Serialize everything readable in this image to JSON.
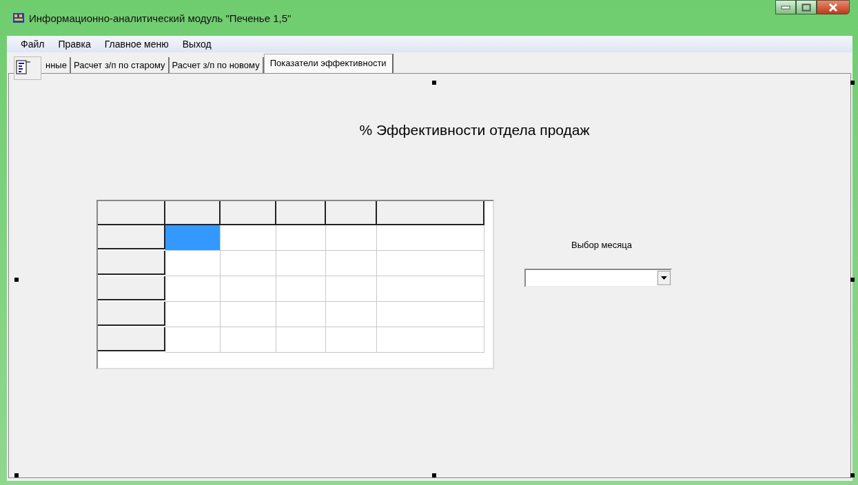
{
  "window": {
    "title": "Информационно-аналитический модуль \"Печенье 1,5\""
  },
  "menu": [
    "Файл",
    "Правка",
    "Главное меню",
    "Выход"
  ],
  "tabs": [
    {
      "label": "нные",
      "selected": false
    },
    {
      "label": "Расчет з/п по старому",
      "selected": false
    },
    {
      "label": "Расчет з/п по новому",
      "selected": false
    },
    {
      "label": "Показатели эффективности",
      "selected": true
    }
  ],
  "heading": "% Эффективности отдела продаж",
  "grid": {
    "rows": [
      {
        "cells": [
          {
            "selected": true
          },
          {
            "selected": false
          },
          {
            "selected": false
          },
          {
            "selected": false
          },
          {
            "selected": false
          }
        ]
      },
      {
        "cells": [
          {
            "selected": false
          },
          {
            "selected": false
          },
          {
            "selected": false
          },
          {
            "selected": false
          },
          {
            "selected": false
          }
        ]
      },
      {
        "cells": [
          {
            "selected": false
          },
          {
            "selected": false
          },
          {
            "selected": false
          },
          {
            "selected": false
          },
          {
            "selected": false
          }
        ]
      },
      {
        "cells": [
          {
            "selected": false
          },
          {
            "selected": false
          },
          {
            "selected": false
          },
          {
            "selected": false
          },
          {
            "selected": false
          }
        ]
      },
      {
        "cells": [
          {
            "selected": false
          },
          {
            "selected": false
          },
          {
            "selected": false
          },
          {
            "selected": false
          },
          {
            "selected": false
          }
        ]
      }
    ]
  },
  "month": {
    "label": "Выбор месяца"
  }
}
